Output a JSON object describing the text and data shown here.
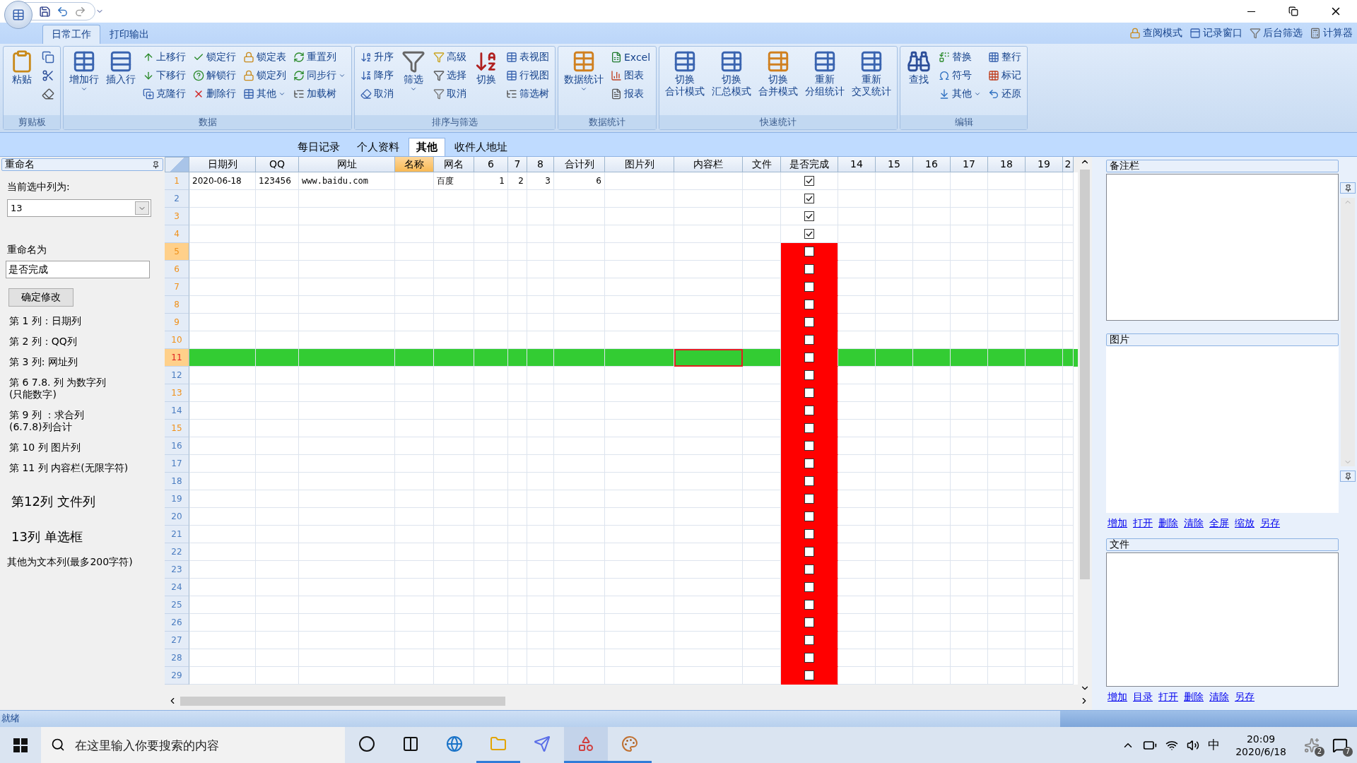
{
  "ribbon": {
    "tabs": [
      {
        "label": "日常工作",
        "selected": true
      },
      {
        "label": "打印输出",
        "selected": false
      }
    ],
    "quick_links": [
      {
        "label": "查阅模式"
      },
      {
        "label": "记录窗口"
      },
      {
        "label": "后台筛选"
      },
      {
        "label": "计算器"
      }
    ],
    "groups": [
      {
        "label": "剪贴板",
        "columns": [
          [
            {
              "kind": "large",
              "label": "粘贴"
            }
          ],
          [
            {
              "kind": "icon"
            },
            {
              "kind": "icon"
            },
            {
              "kind": "icon"
            }
          ]
        ]
      },
      {
        "label": "数据",
        "columns": [
          [
            {
              "kind": "large",
              "label": "增加行",
              "dropdown": true
            }
          ],
          [
            {
              "kind": "large",
              "label": "插入行"
            }
          ],
          [
            {
              "kind": "small",
              "label": "上移行"
            },
            {
              "kind": "small",
              "label": "下移行"
            },
            {
              "kind": "small",
              "label": "克隆行"
            }
          ],
          [
            {
              "kind": "small",
              "label": "锁定行"
            },
            {
              "kind": "small",
              "label": "解锁行"
            },
            {
              "kind": "small",
              "label": "删除行"
            }
          ],
          [
            {
              "kind": "small",
              "label": "锁定表"
            },
            {
              "kind": "small",
              "label": "锁定列"
            },
            {
              "kind": "small",
              "label": "其他",
              "dropdown": true
            }
          ],
          [
            {
              "kind": "small",
              "label": "重置列"
            },
            {
              "kind": "small",
              "label": "同步行",
              "dropdown": true
            },
            {
              "kind": "small",
              "label": "加载树"
            }
          ]
        ]
      },
      {
        "label": "排序与筛选",
        "columns": [
          [
            {
              "kind": "small",
              "label": "升序"
            },
            {
              "kind": "small",
              "label": "降序"
            },
            {
              "kind": "small",
              "label": "取消"
            }
          ],
          [
            {
              "kind": "large",
              "label": "筛选",
              "dropdown": true
            }
          ],
          [
            {
              "kind": "small",
              "label": "高级"
            },
            {
              "kind": "small",
              "label": "选择"
            },
            {
              "kind": "small",
              "label": "取消"
            }
          ],
          [
            {
              "kind": "large",
              "label": "切换"
            }
          ],
          [
            {
              "kind": "small",
              "label": "表视图"
            },
            {
              "kind": "small",
              "label": "行视图"
            },
            {
              "kind": "small",
              "label": "筛选树"
            }
          ]
        ]
      },
      {
        "label": "数据统计",
        "columns": [
          [
            {
              "kind": "large",
              "label": "数据统计",
              "dropdown": true
            }
          ],
          [
            {
              "kind": "small",
              "label": "Excel"
            },
            {
              "kind": "small",
              "label": "图表"
            },
            {
              "kind": "small",
              "label": "报表"
            }
          ]
        ]
      },
      {
        "label": "快速统计",
        "columns": [
          [
            {
              "kind": "large",
              "lines": [
                "切换",
                "合计模式"
              ]
            }
          ],
          [
            {
              "kind": "large",
              "lines": [
                "切换",
                "汇总模式"
              ]
            }
          ],
          [
            {
              "kind": "large",
              "lines": [
                "切换",
                "合并模式"
              ]
            }
          ],
          [
            {
              "kind": "large",
              "lines": [
                "重新",
                "分组统计"
              ]
            }
          ],
          [
            {
              "kind": "large",
              "lines": [
                "重新",
                "交叉统计"
              ]
            }
          ]
        ]
      },
      {
        "label": "编辑",
        "columns": [
          [
            {
              "kind": "large",
              "label": "查找"
            }
          ],
          [
            {
              "kind": "small",
              "label": "替换"
            },
            {
              "kind": "small",
              "label": "符号"
            },
            {
              "kind": "small",
              "label": "其他",
              "dropdown": true
            }
          ],
          [
            {
              "kind": "small",
              "label": "整行"
            },
            {
              "kind": "small",
              "label": "标记"
            },
            {
              "kind": "small",
              "label": "还原"
            }
          ]
        ]
      }
    ]
  },
  "document_tabs": [
    {
      "label": "每日记录",
      "selected": false
    },
    {
      "label": "个人资料",
      "selected": false
    },
    {
      "label": "其他",
      "selected": true
    },
    {
      "label": "收件人地址",
      "selected": false
    }
  ],
  "rename_panel": {
    "title": "重命名",
    "column_label": "当前选中列为:",
    "column_value": "13",
    "rename_label": "重命名为",
    "rename_value": "是否完成",
    "confirm_button": "确定修改",
    "notes": [
      {
        "kind": "normal",
        "text": "第 1 列：日期列"
      },
      {
        "kind": "normal",
        "text": "第 2 列：QQ列"
      },
      {
        "kind": "normal",
        "text": "第 3 列: 网址列"
      },
      {
        "kind": "normal",
        "text": "第 6 7.8. 列 为数字列\n(只能数字)"
      },
      {
        "kind": "normal",
        "text": "第 9 列 ：求合列\n(6.7.8)列合计"
      },
      {
        "kind": "normal",
        "text": "第 10 列 图片列"
      },
      {
        "kind": "normal",
        "text": "第 11 列 内容栏(无限字符)"
      },
      {
        "kind": "large",
        "text": "第12列 文件列"
      },
      {
        "kind": "large",
        "text": "13列 单选框"
      },
      {
        "kind": "small",
        "text": "其他为文本列(最多200字符)"
      }
    ]
  },
  "grid": {
    "columns": [
      {
        "label": "日期列",
        "kind": "text",
        "selected": false,
        "current": false
      },
      {
        "label": "QQ",
        "kind": "text",
        "selected": false,
        "current": false
      },
      {
        "label": "网址",
        "kind": "text",
        "selected": false,
        "current": false
      },
      {
        "label": "名称",
        "kind": "text",
        "selected": true,
        "current": false
      },
      {
        "label": "网名",
        "kind": "text",
        "selected": false,
        "current": false
      },
      {
        "label": "6",
        "kind": "number",
        "selected": false,
        "current": false
      },
      {
        "label": "7",
        "kind": "number",
        "selected": false,
        "current": false
      },
      {
        "label": "8",
        "kind": "number",
        "selected": false,
        "current": false
      },
      {
        "label": "合计列",
        "kind": "number",
        "selected": false,
        "current": false
      },
      {
        "label": "图片列",
        "kind": "text",
        "selected": false,
        "current": false
      },
      {
        "label": "内容栏",
        "kind": "text",
        "selected": false,
        "current": true
      },
      {
        "label": "文件",
        "kind": "text",
        "selected": false,
        "current": false
      },
      {
        "label": "是否完成",
        "kind": "checkbox",
        "selected": false,
        "current": false
      },
      {
        "label": "14",
        "kind": "text",
        "selected": false,
        "current": false
      },
      {
        "label": "15",
        "kind": "text",
        "selected": false,
        "current": false
      },
      {
        "label": "16",
        "kind": "text",
        "selected": false,
        "current": false
      },
      {
        "label": "17",
        "kind": "text",
        "selected": false,
        "current": false
      },
      {
        "label": "18",
        "kind": "text",
        "selected": false,
        "current": false
      },
      {
        "label": "19",
        "kind": "text",
        "selected": false,
        "current": false
      },
      {
        "label": "2",
        "kind": "text",
        "selected": false,
        "current": false
      }
    ],
    "rows": [
      {
        "number": "1",
        "checked": true,
        "selected": false,
        "marked": true,
        "active": false,
        "cells": [
          "2020-06-18",
          "123456",
          "www.baidu.com",
          null,
          "百度",
          "1",
          "2",
          "3",
          "6"
        ]
      },
      {
        "number": "2",
        "checked": true,
        "selected": false,
        "marked": false,
        "active": false
      },
      {
        "number": "3",
        "checked": true,
        "selected": false,
        "marked": true,
        "active": false
      },
      {
        "number": "4",
        "checked": true,
        "selected": false,
        "marked": true,
        "active": false
      },
      {
        "number": "5",
        "checked": false,
        "selected": false,
        "marked": true,
        "active": true
      },
      {
        "number": "6",
        "checked": false,
        "selected": false,
        "marked": true,
        "active": false
      },
      {
        "number": "7",
        "checked": false,
        "selected": false,
        "marked": true,
        "active": false
      },
      {
        "number": "8",
        "checked": false,
        "selected": false,
        "marked": true,
        "active": false
      },
      {
        "number": "9",
        "checked": false,
        "selected": false,
        "marked": true,
        "active": false
      },
      {
        "number": "10",
        "checked": false,
        "selected": false,
        "marked": true,
        "active": false
      },
      {
        "number": "11",
        "checked": false,
        "selected": true,
        "marked": true,
        "active": true
      },
      {
        "number": "12",
        "checked": false,
        "selected": false,
        "marked": false,
        "active": false
      },
      {
        "number": "13",
        "checked": false,
        "selected": false,
        "marked": true,
        "active": false
      },
      {
        "number": "14",
        "checked": false,
        "selected": false,
        "marked": false,
        "active": false
      },
      {
        "number": "15",
        "checked": false,
        "selected": false,
        "marked": true,
        "active": false
      },
      {
        "number": "16",
        "checked": false,
        "selected": false,
        "marked": false,
        "active": false
      },
      {
        "number": "17",
        "checked": false,
        "selected": false,
        "marked": false,
        "active": false
      },
      {
        "number": "18",
        "checked": false,
        "selected": false,
        "marked": false,
        "active": false
      },
      {
        "number": "19",
        "checked": false,
        "selected": false,
        "marked": false,
        "active": false
      },
      {
        "number": "20",
        "checked": false,
        "selected": false,
        "marked": false,
        "active": false
      },
      {
        "number": "21",
        "checked": false,
        "selected": false,
        "marked": false,
        "active": false
      },
      {
        "number": "22",
        "checked": false,
        "selected": false,
        "marked": false,
        "active": false
      },
      {
        "number": "23",
        "checked": false,
        "selected": false,
        "marked": false,
        "active": false
      },
      {
        "number": "24",
        "checked": false,
        "selected": false,
        "marked": false,
        "active": false
      },
      {
        "number": "25",
        "checked": false,
        "selected": false,
        "marked": false,
        "active": false
      },
      {
        "number": "26",
        "checked": false,
        "selected": false,
        "marked": false,
        "active": false
      },
      {
        "number": "27",
        "checked": false,
        "selected": false,
        "marked": false,
        "active": false
      },
      {
        "number": "28",
        "checked": false,
        "selected": false,
        "marked": false,
        "active": false
      },
      {
        "number": "29",
        "checked": false,
        "selected": false,
        "marked": false,
        "active": false
      }
    ]
  },
  "side_panel": {
    "notes_title": "备注栏",
    "picture_title": "图片",
    "picture_links": [
      "增加",
      "打开",
      "删除",
      "清除",
      "全屏",
      "缩放",
      "另存"
    ],
    "file_title": "文件",
    "file_links": [
      "增加",
      "目录",
      "打开",
      "删除",
      "清除",
      "另存"
    ]
  },
  "status_bar": {
    "text": "就绪"
  },
  "taskbar": {
    "search": {
      "placeholder": "在这里输入你要搜索的内容"
    },
    "apps": [
      {
        "running": false,
        "active": false
      },
      {
        "running": false,
        "active": false
      },
      {
        "running": false,
        "active": false
      },
      {
        "running": true,
        "active": false
      },
      {
        "running": false,
        "active": false
      },
      {
        "running": true,
        "active": true
      },
      {
        "running": true,
        "active": false
      }
    ],
    "ime": "中",
    "time": "20:09",
    "date": "2020/6/18",
    "tray_badge": "2",
    "notifications": "7"
  }
}
